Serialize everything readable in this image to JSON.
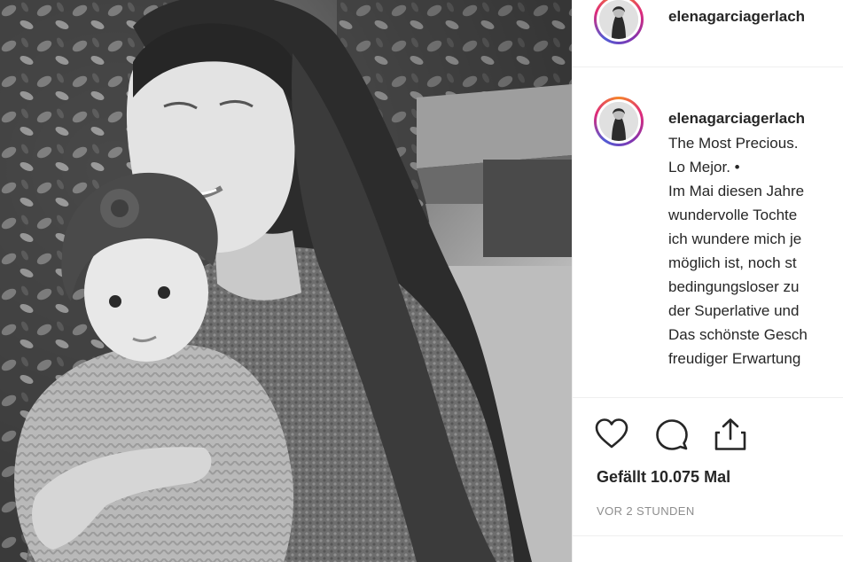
{
  "post": {
    "username": "elenagarciagerlach",
    "caption_lines": [
      "The Most Precious.",
      "Lo Mejor. •",
      "Im Mai diesen Jahre",
      "wundervolle Tochte",
      "ich wundere mich je",
      "möglich ist, noch st",
      "bedingungsloser zu",
      "der Superlative und",
      "Das schönste Gesch",
      "freudiger Erwartung"
    ],
    "likes": "Gefällt 10.075 Mal",
    "timestamp": "VOR 2 STUNDEN"
  },
  "icons": {
    "like": "heart-icon",
    "comment": "comment-bubble-icon",
    "share": "share-upload-icon"
  },
  "colors": {
    "ring_gradient": [
      "#f58529",
      "#dd2a7b",
      "#8134af",
      "#515bd4"
    ],
    "text": "#262626",
    "muted": "#8e8e8e",
    "divider": "#efefef"
  }
}
